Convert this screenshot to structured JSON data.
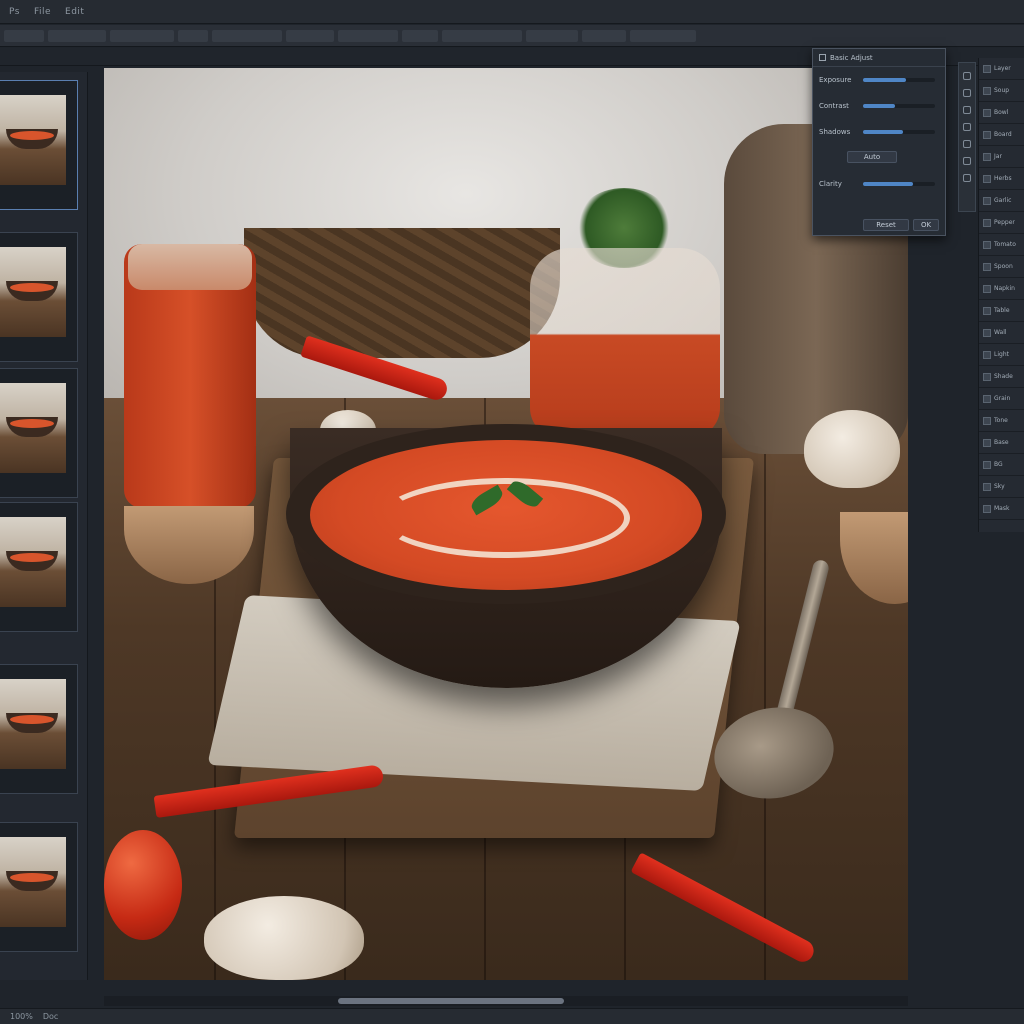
{
  "menubar": {
    "items": [
      "Ps",
      "File",
      "Edit"
    ]
  },
  "filmstrip": {
    "thumbnail_count": 6,
    "selected_index": 0
  },
  "float_panel": {
    "title": "Basic Adjust",
    "rows": [
      {
        "label": "Exposure",
        "value": 0.6
      },
      {
        "label": "Contrast",
        "value": 0.45
      },
      {
        "label": "Shadows",
        "value": 0.55
      },
      {
        "label": "Clarity",
        "value": 0.7
      }
    ],
    "btn_a": "Auto",
    "btn_b": "Reset",
    "btn_c": "OK"
  },
  "right_panel": {
    "items": [
      "Layer",
      "Soup",
      "Bowl",
      "Board",
      "Jar",
      "Herbs",
      "Garlic",
      "Pepper",
      "Tomato",
      "Spoon",
      "Napkin",
      "Table",
      "Wall",
      "Light",
      "Shade",
      "Grain",
      "Tone",
      "Base",
      "BG",
      "Sky",
      "Mask"
    ]
  },
  "status": {
    "zoom": "100%",
    "doc": "Doc"
  },
  "colors": {
    "accent": "#4f86c6",
    "panel": "#262c34",
    "canvas_bg": "#1f242b"
  }
}
